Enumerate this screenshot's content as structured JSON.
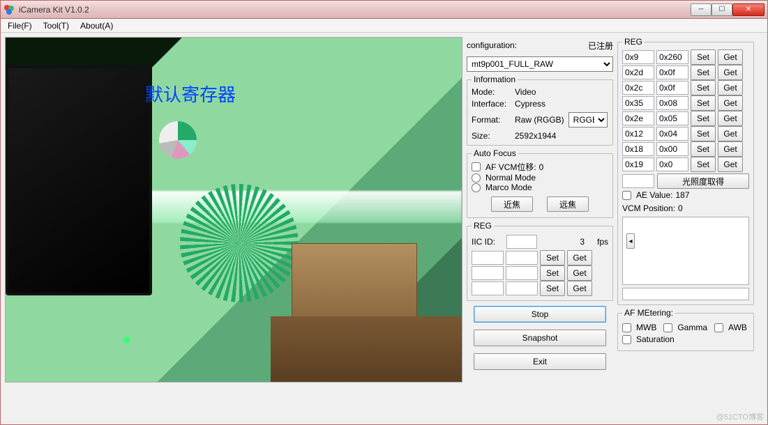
{
  "window": {
    "title": "iCamera Kit V1.0.2"
  },
  "menu": {
    "file": "File(F)",
    "tool": "Tool(T)",
    "about": "About(A)"
  },
  "preview": {
    "overlay": "默认寄存器"
  },
  "config": {
    "label": "configuration:",
    "status": "已注册",
    "selected": "mt9p001_FULL_RAW"
  },
  "info": {
    "legend": "Information",
    "mode_label": "Mode:",
    "mode_value": "Video",
    "interface_label": "Interface:",
    "interface_value": "Cypress",
    "format_label": "Format:",
    "format_value": "Raw (RGGB)",
    "format_select": "RGGB",
    "size_label": "Size:",
    "size_value": "2592x1944"
  },
  "af": {
    "legend": "Auto Focus",
    "af_label": "AF  VCM位移:",
    "af_shift": "0",
    "normal": "Normal Mode",
    "macro": "Marco Mode",
    "near": "近焦",
    "far": "远焦"
  },
  "reg_left": {
    "legend": "REG",
    "iic_label": "IIC ID:",
    "iic_value": "",
    "fps_value": "3",
    "fps_label": "fps",
    "set": "Set",
    "get": "Get"
  },
  "actions": {
    "stop": "Stop",
    "snapshot": "Snapshot",
    "exit": "Exit"
  },
  "reg_right": {
    "legend": "REG",
    "rows": [
      {
        "a": "0x9",
        "b": "0x260"
      },
      {
        "a": "0x2d",
        "b": "0x0f"
      },
      {
        "a": "0x2c",
        "b": "0x0f"
      },
      {
        "a": "0x35",
        "b": "0x08"
      },
      {
        "a": "0x2e",
        "b": "0x05"
      },
      {
        "a": "0x12",
        "b": "0x04"
      },
      {
        "a": "0x18",
        "b": "0x00"
      },
      {
        "a": "0x19",
        "b": "0x0"
      }
    ],
    "set": "Set",
    "get": "Get",
    "lux_btn": "光照度取得",
    "ae_label": "AE Value:",
    "ae_value": "187",
    "vcm_label": "VCM Position:",
    "vcm_value": "0"
  },
  "metering": {
    "legend": "AF MEtering:",
    "mwb": "MWB",
    "gamma": "Gamma",
    "awb": "AWB",
    "saturation": "Saturation"
  },
  "watermark": "@51CTO博客"
}
